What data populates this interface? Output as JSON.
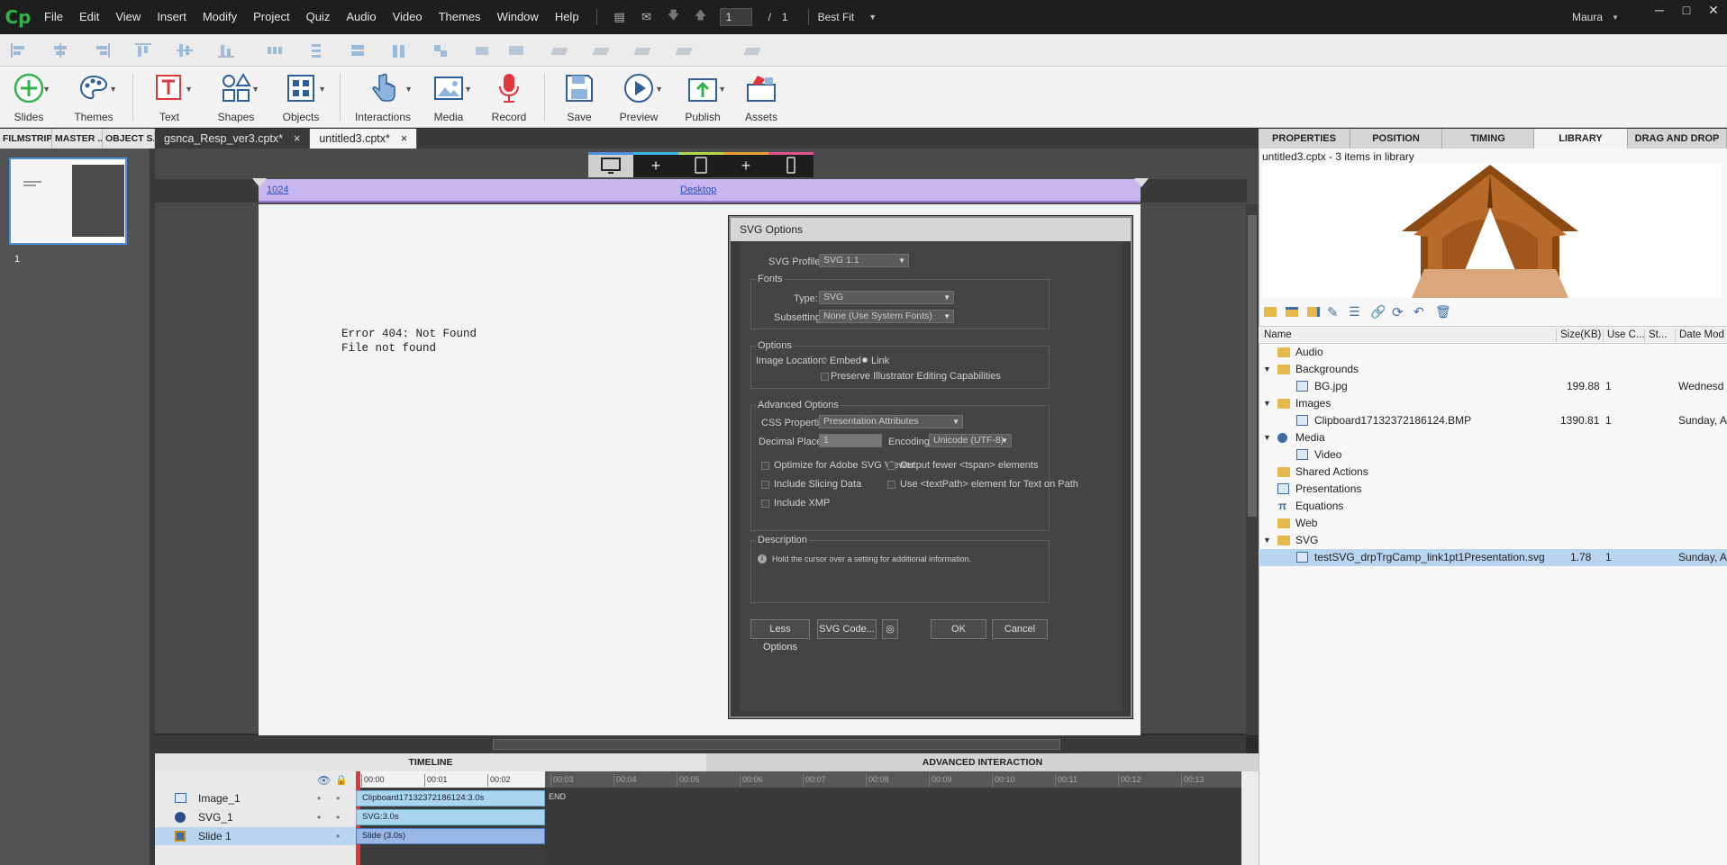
{
  "menubar": {
    "logo": "Cp",
    "items": [
      "File",
      "Edit",
      "View",
      "Insert",
      "Modify",
      "Project",
      "Quiz",
      "Audio",
      "Video",
      "Themes",
      "Window",
      "Help"
    ],
    "page_current": "1",
    "page_sep": "/",
    "page_total": "1",
    "zoom": "Best Fit",
    "user": "Maura"
  },
  "toolbar": {
    "slides": "Slides",
    "themes": "Themes",
    "text": "Text",
    "shapes": "Shapes",
    "objects": "Objects",
    "interactions": "Interactions",
    "media": "Media",
    "record": "Record",
    "save": "Save",
    "preview": "Preview",
    "publish": "Publish",
    "assets": "Assets"
  },
  "left_tabs": [
    "FILMSTRIP",
    "MASTER ...",
    "OBJECT S..."
  ],
  "doc_tabs": [
    {
      "label": "gsnca_Resp_ver3.cptx*",
      "close": "×"
    },
    {
      "label": "untitled3.cptx*",
      "close": "×"
    }
  ],
  "filmstrip": {
    "slide_number": "1"
  },
  "stage": {
    "ruler_width": "1024",
    "view": "Desktop",
    "error_line1": "Error 404: Not Found",
    "error_line2": "File not found"
  },
  "dialog": {
    "title": "SVG Options",
    "svg_profiles_label": "SVG Profiles:",
    "svg_profiles_value": "SVG 1.1",
    "fonts_group": "Fonts",
    "type_label": "Type:",
    "type_value": "SVG",
    "subsetting_label": "Subsetting:",
    "subsetting_value": "None (Use System Fonts)",
    "options_group": "Options",
    "image_location_label": "Image Location:",
    "embed_label": "Embed",
    "link_label": "Link",
    "preserve_label": "Preserve Illustrator Editing Capabilities",
    "advanced_group": "Advanced Options",
    "css_label": "CSS Properties:",
    "css_value": "Presentation Attributes",
    "decimal_label": "Decimal Places:",
    "decimal_value": "1",
    "encoding_label": "Encoding:",
    "encoding_value": "Unicode (UTF-8)",
    "opt_optimize": "Optimize for Adobe SVG Viewer",
    "opt_slicing": "Include Slicing Data",
    "opt_xmp": "Include XMP",
    "opt_tspan": "Output fewer <tspan> elements",
    "opt_textpath": "Use <textPath> element for Text on Path",
    "description_group": "Description",
    "description_text": "Hold the cursor over a setting for additional information.",
    "less_options": "Less Options",
    "svg_code": "SVG Code...",
    "ok": "OK",
    "cancel": "Cancel"
  },
  "right_tabs": [
    "PROPERTIES",
    "POSITION",
    "TIMING",
    "LIBRARY",
    "DRAG AND DROP"
  ],
  "library": {
    "header": "untitled3.cptx - 3 items in library",
    "columns": {
      "name": "Name",
      "size": "Size(KB)",
      "use": "Use C...",
      "st": "St...",
      "date": "Date Mod"
    },
    "rows": [
      {
        "name": "Audio",
        "size": "",
        "use": "",
        "date": ""
      },
      {
        "name": "Backgrounds",
        "size": "",
        "use": "",
        "date": ""
      },
      {
        "name": "BG.jpg",
        "size": "199.88",
        "use": "1",
        "date": "Wednesd"
      },
      {
        "name": "Images",
        "size": "",
        "use": "",
        "date": ""
      },
      {
        "name": "Clipboard17132372186124.BMP",
        "size": "1390.81",
        "use": "1",
        "date": "Sunday, A"
      },
      {
        "name": "Media",
        "size": "",
        "use": "",
        "date": ""
      },
      {
        "name": "Video",
        "size": "",
        "use": "",
        "date": ""
      },
      {
        "name": "Shared Actions",
        "size": "",
        "use": "",
        "date": ""
      },
      {
        "name": "Presentations",
        "size": "",
        "use": "",
        "date": ""
      },
      {
        "name": "Equations",
        "size": "",
        "use": "",
        "date": ""
      },
      {
        "name": "Web",
        "size": "",
        "use": "",
        "date": ""
      },
      {
        "name": "SVG",
        "size": "",
        "use": "",
        "date": ""
      },
      {
        "name": "testSVG_drpTrgCamp_link1pt1Presentation.svg",
        "size": "1.78",
        "use": "1",
        "date": "Sunday, A"
      }
    ]
  },
  "timeline": {
    "title": "TIMELINE",
    "advanced": "ADVANCED INTERACTION",
    "ticks": [
      "00:00",
      "00:01",
      "00:02",
      "00:03",
      "00:04",
      "00:05",
      "00:06",
      "00:07",
      "00:08",
      "00:09",
      "00:10",
      "00:11",
      "00:12",
      "00:13"
    ],
    "end": "END",
    "layers": [
      {
        "name": "Image_1",
        "bar": "Clipboard17132372186124:3.0s"
      },
      {
        "name": "SVG_1",
        "bar": "SVG:3.0s"
      },
      {
        "name": "Slide 1",
        "bar": "Slide (3.0s)"
      }
    ]
  },
  "colors": {
    "accent": "#4a90e2",
    "brand": "#2fb34a",
    "record": "#e0373f",
    "selection": "#b9d4ef"
  }
}
